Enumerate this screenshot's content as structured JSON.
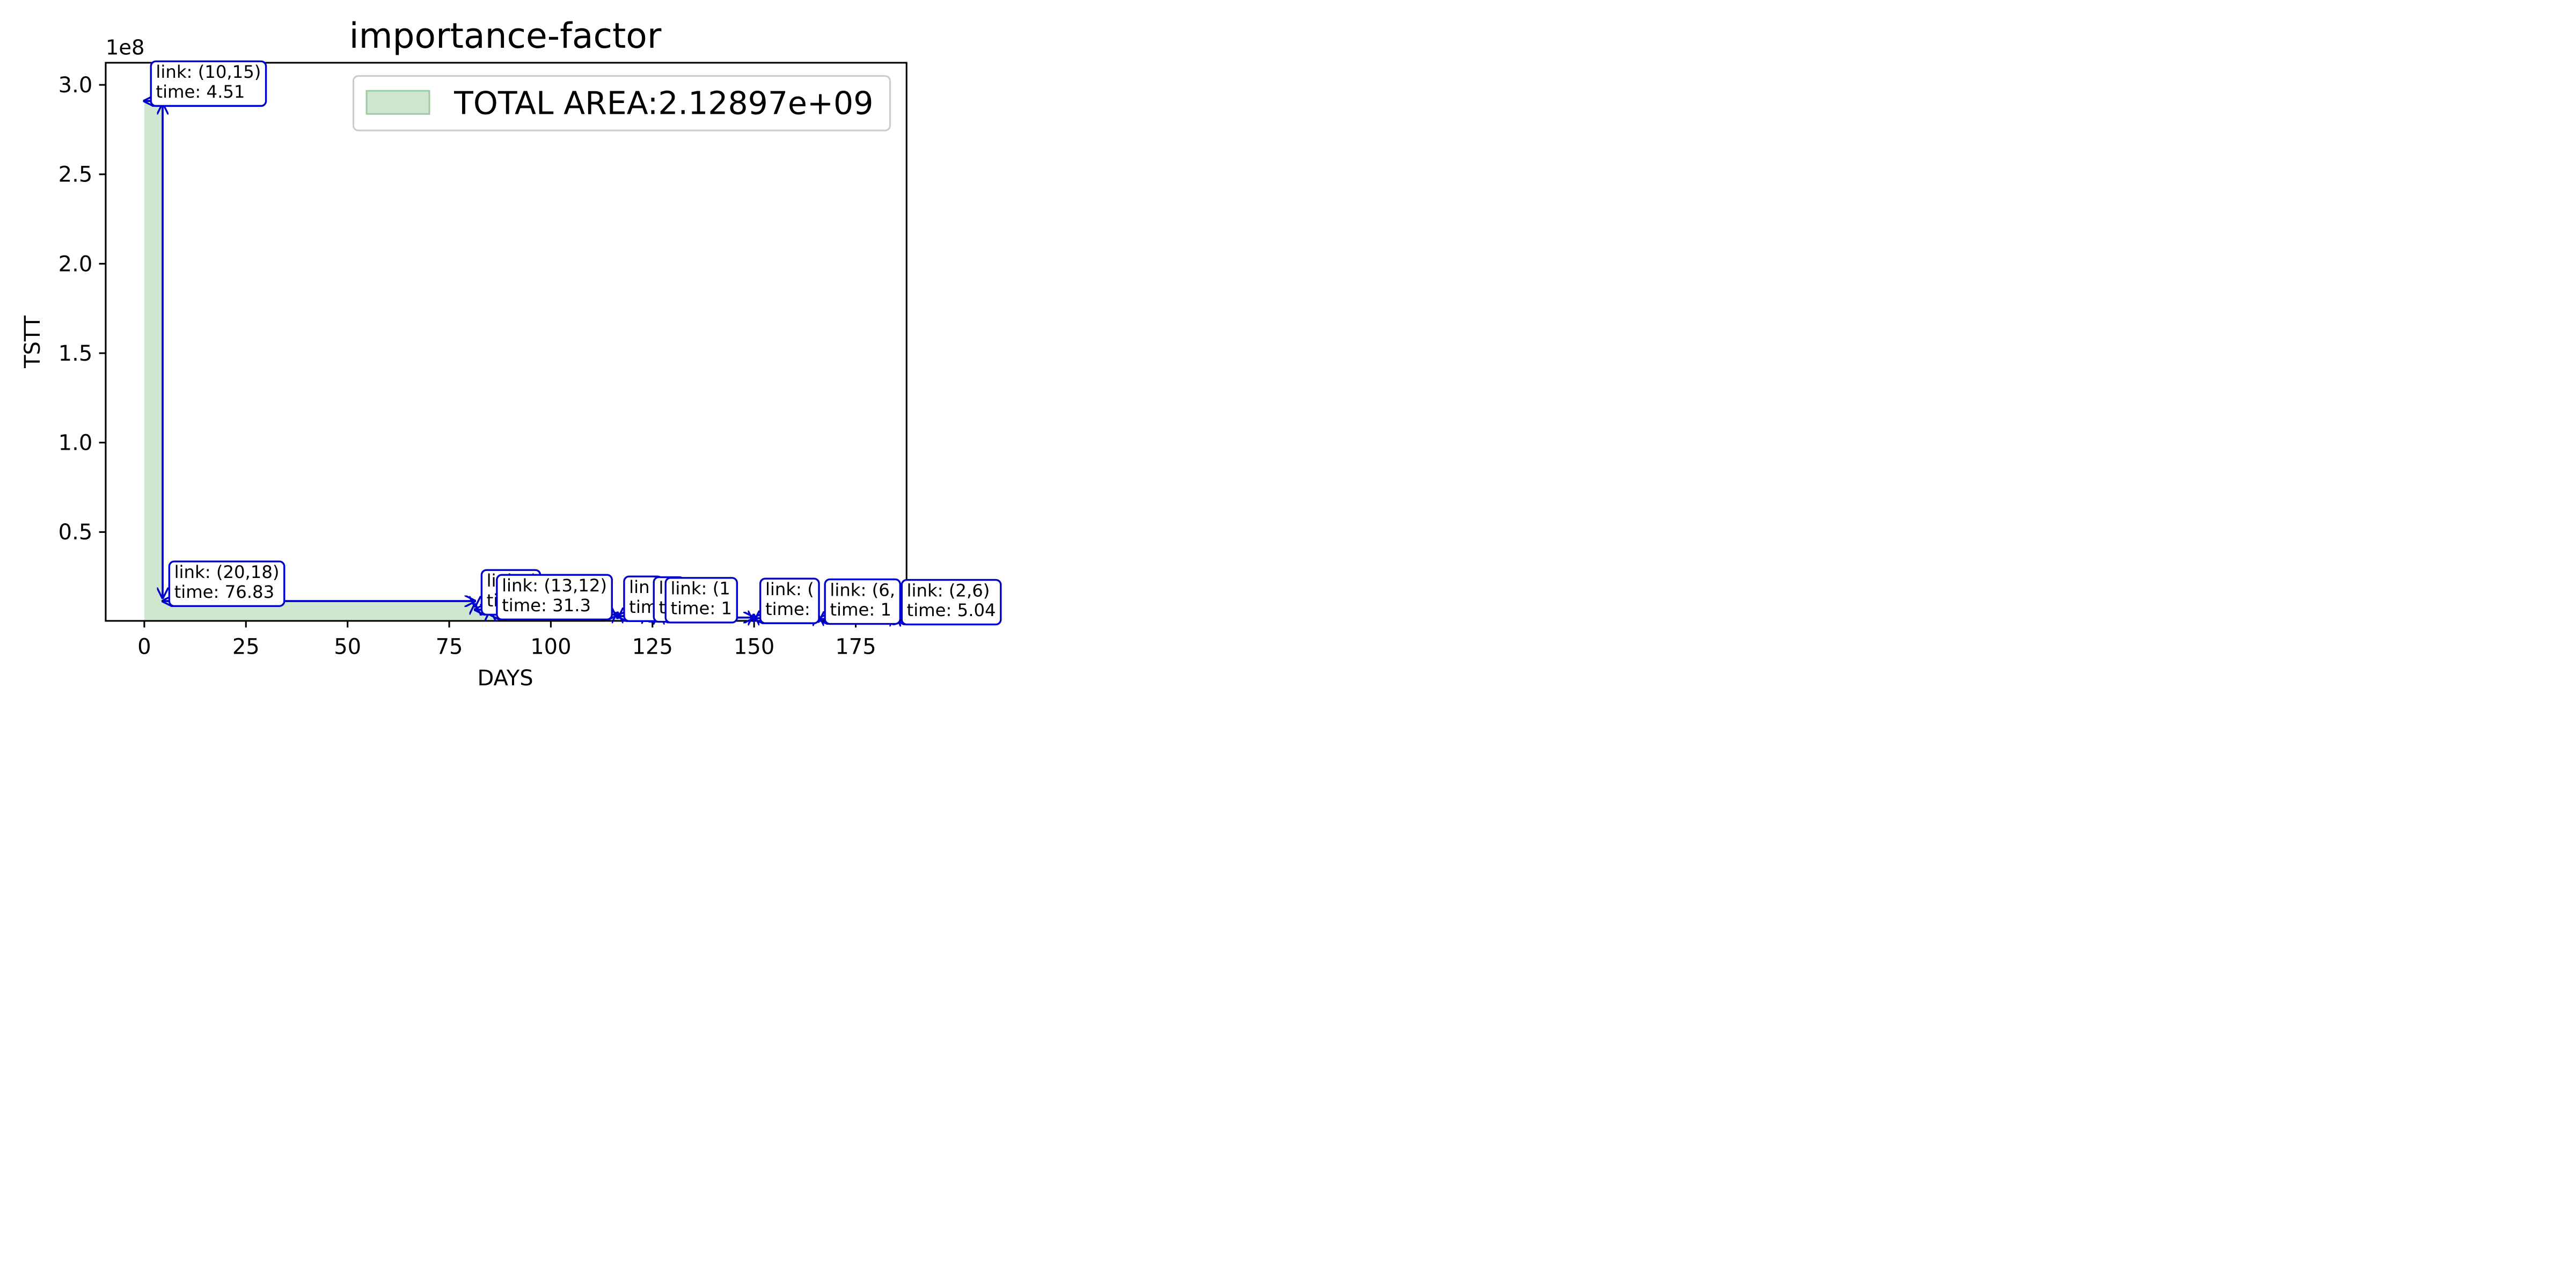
{
  "chart_data": {
    "type": "area",
    "title": "importance-factor",
    "xlabel": "DAYS",
    "ylabel": "TSTT",
    "y_offset_text": "1e8",
    "xlim": [
      -9.5,
      187.5
    ],
    "ylim": [
      0.0033,
      3.1237
    ],
    "x_ticks": [
      0,
      25,
      50,
      75,
      100,
      125,
      150,
      175
    ],
    "x_tick_labels": [
      "0",
      "25",
      "50",
      "75",
      "100",
      "125",
      "150",
      "175"
    ],
    "y_ticks": [
      0.5,
      1.0,
      1.5,
      2.0,
      2.5,
      3.0
    ],
    "y_tick_labels": [
      "0.5",
      "1.0",
      "1.5",
      "2.0",
      "2.5",
      "3.0"
    ],
    "grid": false,
    "legend": {
      "position": "top-right",
      "label": "TOTAL AREA:2.12897e+09"
    },
    "fill_color": "#cfe6d0",
    "fill_edge_color": "#9fcca3",
    "arrow_color": "#0000cc",
    "series": [
      {
        "x": [
          0,
          4.51,
          4.51,
          81.34,
          81.34,
          85.1,
          85.1,
          116.4,
          116.4,
          123.7,
          123.7,
          126.6,
          126.6,
          131.8,
          131.8,
          149.9,
          149.9,
          165.8,
          165.8,
          184.7,
          184.7,
          186.6,
          186.6
        ],
        "y": [
          2.91,
          2.91,
          0.114,
          0.114,
          0.066,
          0.066,
          0.039,
          0.039,
          0.03,
          0.03,
          0.026,
          0.026,
          0.022,
          0.022,
          0.018,
          0.018,
          0.014,
          0.014,
          0.011,
          0.011,
          0.0082,
          0.0082,
          0.0033
        ]
      }
    ],
    "annotations": [
      {
        "lines": [
          "link: (10,15)",
          "time: 4.51"
        ],
        "start": 0,
        "end": 4.51,
        "y": 2.91
      },
      {
        "lines": [
          "link: (20,18)",
          "time: 76.83"
        ],
        "start": 4.51,
        "end": 81.34,
        "y": 0.114
      },
      {
        "lines": [
          "link: (",
          "time:"
        ],
        "start": 81.34,
        "end": 85.1,
        "y": 0.066
      },
      {
        "lines": [
          "link: (13,12)",
          "time: 31.3"
        ],
        "start": 85.1,
        "end": 116.4,
        "y": 0.039
      },
      {
        "lines": [
          "lin",
          "tim"
        ],
        "start": 116.4,
        "end": 123.7,
        "y": 0.03
      },
      {
        "lines": [
          "lin",
          "t"
        ],
        "start": 123.7,
        "end": 126.6,
        "y": 0.026
      },
      {
        "lines": [
          "link: (1",
          "time: 1"
        ],
        "start": 126.6,
        "end": 149.9,
        "y": 0.022
      },
      {
        "lines": [
          "link: (",
          "time:"
        ],
        "start": 149.9,
        "end": 165.8,
        "y": 0.018
      },
      {
        "lines": [
          "link: (6,",
          "time: 1"
        ],
        "start": 165.8,
        "end": 184.7,
        "y": 0.014
      },
      {
        "lines": [
          "link: (2,6)",
          "time: 5.04"
        ],
        "start": 184.7,
        "end": 186.6,
        "y": 0.011
      }
    ]
  }
}
